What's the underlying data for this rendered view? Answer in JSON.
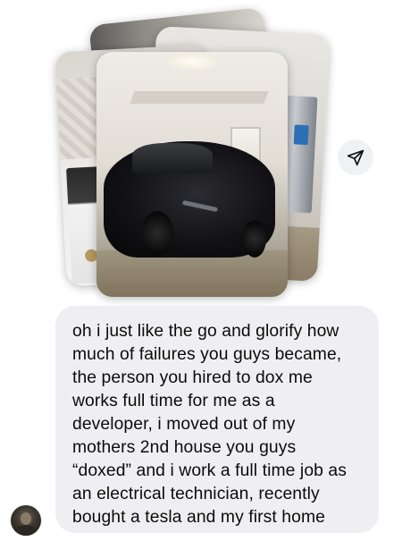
{
  "conversation": {
    "shared_photos": {
      "count_shown": 4,
      "images": [
        {
          "name": "room-corner-photo"
        },
        {
          "name": "kitchen-fridge-photo"
        },
        {
          "name": "kitchen-stove-photo"
        },
        {
          "name": "tesla-in-garage-photo"
        }
      ]
    },
    "share_action": {
      "icon": "share-send-icon"
    },
    "message": {
      "lines": [
        "oh i just like the go and glorify how",
        "much of failures you guys became,",
        "the person you hired to dox me",
        "works full time for me as a",
        "developer, i moved out of my",
        "mothers 2nd house you guys",
        "“doxed” and i work a full time job as",
        "an electrical technician, recently",
        "bought a tesla and my first home"
      ]
    },
    "sender": {
      "avatar_icon": "profile-avatar"
    }
  },
  "colors": {
    "background": "#ffffff",
    "bubble": "#efeff3",
    "text": "#0b0b0b",
    "share_button_bg": "#f0f1f4"
  }
}
